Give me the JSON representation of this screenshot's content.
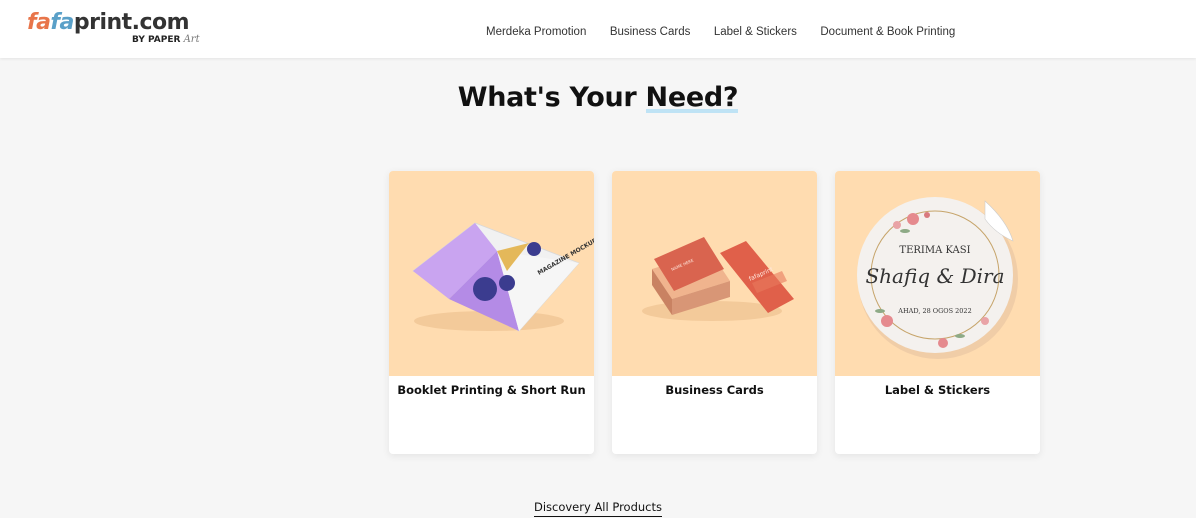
{
  "header": {
    "logo": {
      "part1": "fa",
      "part2": "fa",
      "rest": "print.com",
      "sub": "BY PAPER",
      "sub_art": "Art"
    },
    "nav": [
      {
        "label": "Merdeka Promotion"
      },
      {
        "label": "Business Cards"
      },
      {
        "label": "Label & Stickers"
      },
      {
        "label": "Document & Book Printing"
      }
    ]
  },
  "main": {
    "title_prefix": "What's Your ",
    "title_highlight": "Need?",
    "cards": [
      {
        "label": "Booklet Printing & Short Run",
        "image": "magazine-mockup-image"
      },
      {
        "label": "Business Cards",
        "image": "business-cards-image"
      },
      {
        "label": "Label & Stickers",
        "image": "round-sticker-image"
      }
    ],
    "sticker_text": {
      "line1": "TERIMA KASI",
      "line2": "Shafiq & Dira",
      "line3": "AHAD, 28 OGOS 2022"
    },
    "bizcard_text": "fafaprint",
    "magazine_text": "MAGAZINE MOCKUP",
    "discover_label": "Discovery All Products"
  },
  "colors": {
    "card_image_bg": "#ffdcb0",
    "highlight": "#bfe3f5",
    "page_bg": "#f6f6f6"
  }
}
